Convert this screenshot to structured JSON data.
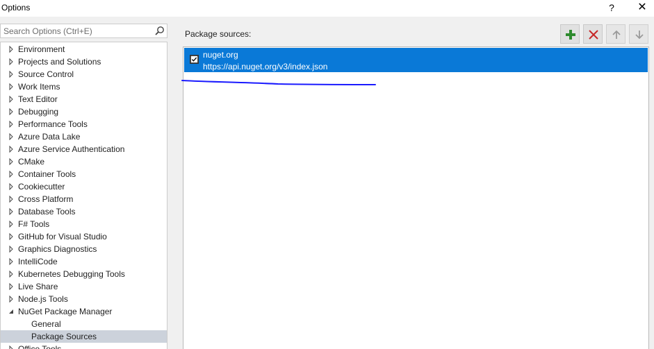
{
  "window": {
    "title": "Options",
    "help_glyph": "?",
    "close_glyph": "✕"
  },
  "search": {
    "placeholder": "Search Options (Ctrl+E)",
    "value": ""
  },
  "tree": {
    "items": [
      {
        "label": "Environment",
        "state": "collapsed"
      },
      {
        "label": "Projects and Solutions",
        "state": "collapsed"
      },
      {
        "label": "Source Control",
        "state": "collapsed"
      },
      {
        "label": "Work Items",
        "state": "collapsed"
      },
      {
        "label": "Text Editor",
        "state": "collapsed"
      },
      {
        "label": "Debugging",
        "state": "collapsed"
      },
      {
        "label": "Performance Tools",
        "state": "collapsed"
      },
      {
        "label": "Azure Data Lake",
        "state": "collapsed"
      },
      {
        "label": "Azure Service Authentication",
        "state": "collapsed"
      },
      {
        "label": "CMake",
        "state": "collapsed"
      },
      {
        "label": "Container Tools",
        "state": "collapsed"
      },
      {
        "label": "Cookiecutter",
        "state": "collapsed"
      },
      {
        "label": "Cross Platform",
        "state": "collapsed"
      },
      {
        "label": "Database Tools",
        "state": "collapsed"
      },
      {
        "label": "F# Tools",
        "state": "collapsed"
      },
      {
        "label": "GitHub for Visual Studio",
        "state": "collapsed"
      },
      {
        "label": "Graphics Diagnostics",
        "state": "collapsed"
      },
      {
        "label": "IntelliCode",
        "state": "collapsed"
      },
      {
        "label": "Kubernetes Debugging Tools",
        "state": "collapsed"
      },
      {
        "label": "Live Share",
        "state": "collapsed"
      },
      {
        "label": "Node.js Tools",
        "state": "collapsed"
      },
      {
        "label": "NuGet Package Manager",
        "state": "expanded"
      },
      {
        "label": "General",
        "state": "child"
      },
      {
        "label": "Package Sources",
        "state": "child-selected"
      },
      {
        "label": "Office Tools",
        "state": "collapsed"
      }
    ]
  },
  "package_sources": {
    "label": "Package sources:",
    "toolbar": {
      "add_icon": "plus-icon",
      "remove_icon": "x-icon",
      "up_icon": "arrow-up-icon",
      "down_icon": "arrow-down-icon"
    },
    "sources": [
      {
        "name": "nuget.org",
        "url": "https://api.nuget.org/v3/index.json",
        "checked": true
      }
    ]
  },
  "colors": {
    "selection": "#0a79d7",
    "tree_selected": "#ccd2db",
    "add_green": "#2e8b2e",
    "remove_red": "#c62828",
    "annotation_stroke": "#1a1aff"
  }
}
